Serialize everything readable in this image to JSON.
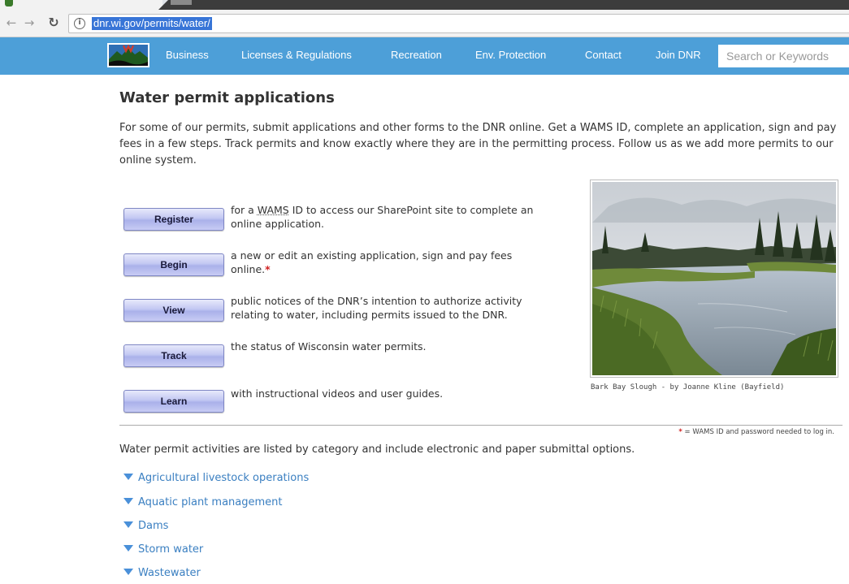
{
  "browser": {
    "url": "dnr.wi.gov/permits/water/"
  },
  "nav": {
    "items": [
      "Business",
      "Licenses & Regulations",
      "Recreation",
      "Env. Protection",
      "Contact",
      "Join DNR"
    ],
    "search_placeholder": "Search or Keywords"
  },
  "page": {
    "title": "Water permit applications",
    "intro": "For some of our permits, submit applications and other forms to the DNR online. Get a WAMS ID, complete an application, sign and pay fees in a few steps. Track permits and know exactly where they are in the permitting process. Follow us as we add more permits to our online system."
  },
  "steps": [
    {
      "label": "Register",
      "desc_pre": "for a ",
      "desc_abbr": "WAMS",
      "desc_post": " ID to access our SharePoint site to complete an online application."
    },
    {
      "label": "Begin",
      "desc": "a new or edit an existing application, sign and pay fees online.",
      "mark": "*"
    },
    {
      "label": "View",
      "desc": "public notices of the DNR’s intention to authorize activity relating to water, including permits issued to the DNR."
    },
    {
      "label": "Track",
      "desc": "the status of Wisconsin water permits."
    },
    {
      "label": "Learn",
      "desc": "with instructional videos and user guides."
    }
  ],
  "photo": {
    "caption": "Bark Bay Slough - by Joanne Kline (Bayfield)"
  },
  "footnote": {
    "star": "*",
    "text": " = WAMS ID and password needed to log in."
  },
  "activities": {
    "intro": "Water permit activities are listed by category and include electronic and paper submittal options.",
    "categories": [
      "Agricultural livestock operations",
      "Aquatic plant management",
      "Dams",
      "Storm water",
      "Wastewater"
    ]
  },
  "colors": {
    "nav_bar": "#4d9fd8",
    "link": "#3a7fc1",
    "required_mark": "#d01f1f"
  }
}
